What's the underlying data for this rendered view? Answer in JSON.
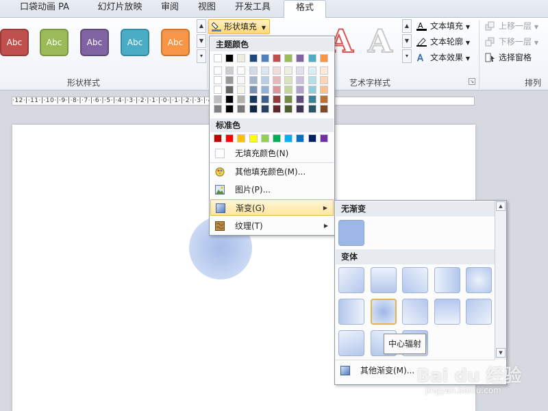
{
  "tabs": [
    "口袋动画 PA",
    "幻灯片放映",
    "审阅",
    "视图",
    "开发工具",
    "格式"
  ],
  "ribbon": {
    "shape_styles": [
      {
        "label": "Abc",
        "color": "#c0504d"
      },
      {
        "label": "Abc",
        "color": "#9bbb59"
      },
      {
        "label": "Abc",
        "color": "#8064a2"
      },
      {
        "label": "Abc",
        "color": "#4bacc6"
      },
      {
        "label": "Abc",
        "color": "#f79646"
      }
    ],
    "shape_fill_label": "形状填充",
    "shape_styles_group": "形状样式",
    "wordart_group": "艺术字样式",
    "text_fill": "文本填充",
    "text_outline": "文本轮廓",
    "text_effects": "文本效果",
    "arrange_group": "排列",
    "bring_forward": "上移一层",
    "send_backward": "下移一层",
    "selection_pane": "选择窗格"
  },
  "ruler": "·12·|·11·|·10·|·9·|·8·|·7·|·6·|·5·|·4·|·3·|·2·|·1·|·0·|·1·|·2·|·3·|·4·|·5·|·6·|·7·|·8·|·9·|·10·|·11·|·12·|",
  "color_menu": {
    "theme_colors_header": "主题颜色",
    "standard_colors_header": "标准色",
    "theme_top": [
      "#ffffff",
      "#000000",
      "#eeece1",
      "#1f497d",
      "#4f81bd",
      "#c0504d",
      "#9bbb59",
      "#8064a2",
      "#4bacc6",
      "#f79646"
    ],
    "standard_colors": [
      "#c00000",
      "#ff0000",
      "#ffc000",
      "#ffff00",
      "#92d050",
      "#00b050",
      "#00b0f0",
      "#0070c0",
      "#002060",
      "#7030a0"
    ],
    "no_fill": "无填充颜色(N)",
    "more_colors": "其他填充颜色(M)...",
    "picture": "图片(P)...",
    "gradient": "渐变(G)",
    "texture": "纹理(T)"
  },
  "gradient_menu": {
    "no_gradient_header": "无渐变",
    "variants_header": "变体",
    "tooltip": "中心辐射",
    "more_gradients": "其他渐变(M)..."
  },
  "watermark": {
    "logo": "Bai du 经验",
    "url": "jingyan.baidu.com"
  }
}
